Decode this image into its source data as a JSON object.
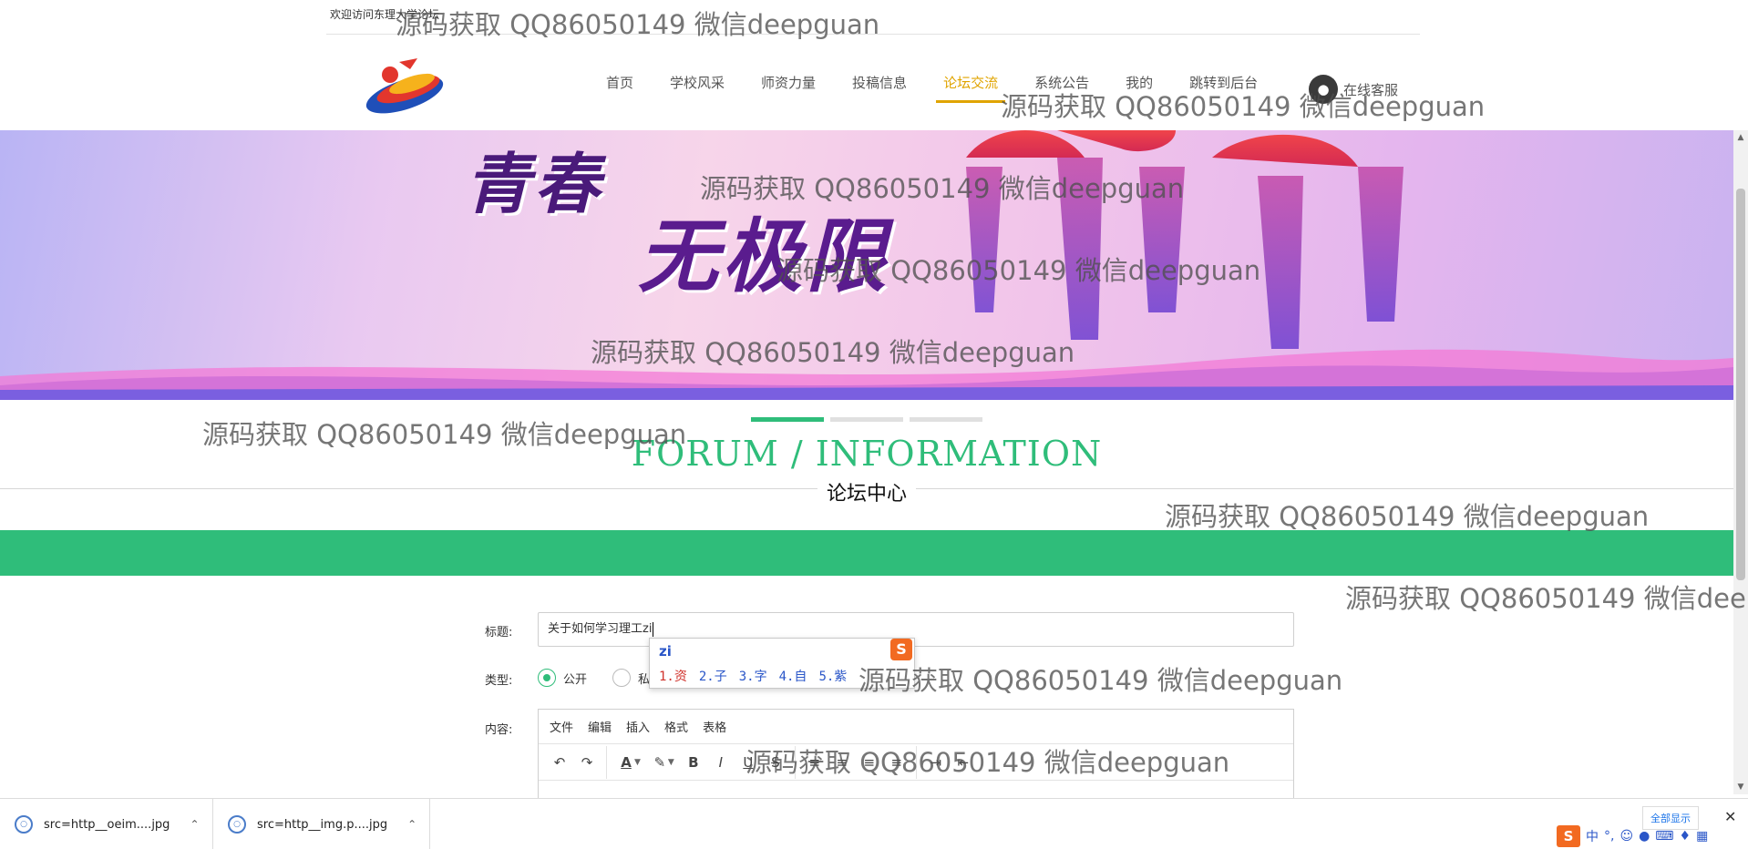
{
  "topbar": {
    "welcome": "欢迎访问东理大学论坛"
  },
  "nav": {
    "items": [
      "首页",
      "学校风采",
      "师资力量",
      "投稿信息",
      "论坛交流",
      "系统公告",
      "我的",
      "跳转到后台"
    ],
    "active_index": 4,
    "service_label": "在线客服"
  },
  "banner": {
    "line1": "青春",
    "line2": "无极限"
  },
  "carousel": {
    "slide_count": 3,
    "active_index": 0
  },
  "section": {
    "title_en": "FORUM / INFORMATION",
    "title_cn": "论坛中心"
  },
  "form": {
    "title_label": "标题:",
    "title_value": "关于如何学习理工zi",
    "type_label": "类型:",
    "type_options": [
      "公开",
      "私"
    ],
    "type_selected": "公开",
    "content_label": "内容:"
  },
  "ime": {
    "pinyin": "zi",
    "candidates": [
      "1.资",
      "2.子",
      "3.字",
      "4.自",
      "5.紫"
    ],
    "logo": "S"
  },
  "editor": {
    "menus": [
      "文件",
      "编辑",
      "插入",
      "格式",
      "表格"
    ],
    "toolbar": [
      "undo-icon",
      "redo-icon",
      "font-color-icon",
      "highlight-icon",
      "bold-icon",
      "italic-icon",
      "underline-icon",
      "strikethrough-icon",
      "align-left-icon",
      "align-center-icon",
      "align-right-icon",
      "align-justify-icon",
      "indent-icon",
      "outdent-icon"
    ],
    "bold_label": "B",
    "italic_label": "I",
    "underline_label": "U",
    "strike_label": "S"
  },
  "watermark": "源码获取 QQ86050149 微信deepguan",
  "downloads": {
    "items": [
      "src=http__oeim....jpg",
      "src=http__img.p....jpg"
    ],
    "show_all": "全部显示"
  },
  "tray": {
    "ime_mode": "中",
    "punct": "°,"
  }
}
